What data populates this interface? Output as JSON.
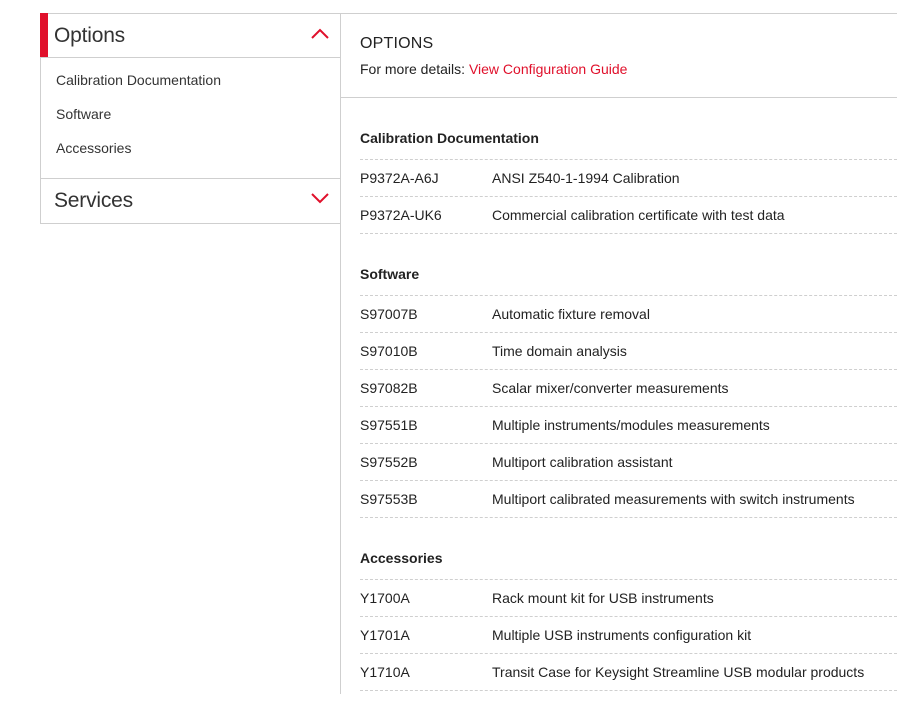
{
  "sidebar": {
    "options_label": "Options",
    "services_label": "Services",
    "items": [
      {
        "label": "Calibration Documentation"
      },
      {
        "label": "Software"
      },
      {
        "label": "Accessories"
      }
    ]
  },
  "main": {
    "title": "OPTIONS",
    "details_prefix": "For more details: ",
    "details_link": "View Configuration Guide",
    "sections": [
      {
        "title": "Calibration Documentation",
        "rows": [
          {
            "code": "P9372A-A6J",
            "desc": "ANSI Z540-1-1994 Calibration"
          },
          {
            "code": "P9372A-UK6",
            "desc": "Commercial calibration certificate with test data"
          }
        ]
      },
      {
        "title": "Software",
        "rows": [
          {
            "code": "S97007B",
            "desc": "Automatic fixture removal"
          },
          {
            "code": "S97010B",
            "desc": "Time domain analysis"
          },
          {
            "code": "S97082B",
            "desc": "Scalar mixer/converter measurements"
          },
          {
            "code": "S97551B",
            "desc": "Multiple instruments/modules measurements"
          },
          {
            "code": "S97552B",
            "desc": "Multiport calibration assistant"
          },
          {
            "code": "S97553B",
            "desc": "Multiport calibrated measurements with switch instruments"
          }
        ]
      },
      {
        "title": "Accessories",
        "rows": [
          {
            "code": "Y1700A",
            "desc": "Rack mount kit for USB instruments"
          },
          {
            "code": "Y1701A",
            "desc": "Multiple USB instruments configuration kit"
          },
          {
            "code": "Y1710A",
            "desc": "Transit Case for Keysight Streamline USB modular products"
          }
        ]
      }
    ]
  },
  "colors": {
    "accent": "#e0102b",
    "border": "#cfcfcf",
    "text": "#222222"
  },
  "icons": {
    "options_toggle": "chevron-up-icon",
    "services_toggle": "chevron-down-icon"
  }
}
